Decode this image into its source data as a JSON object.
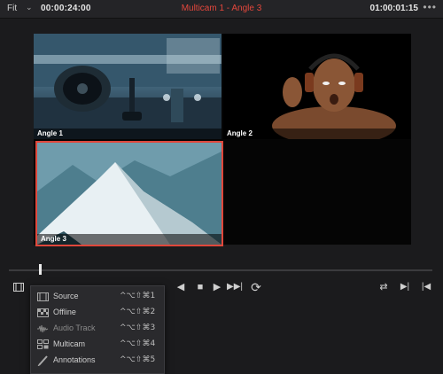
{
  "topbar": {
    "fit_label": "Fit",
    "fit_chevron": "⌄",
    "timecode_left": "00:00:24:00",
    "title": "Multicam 1 - Angle 3",
    "timecode_right": "01:00:01:15",
    "more_icon": "•••"
  },
  "angles": [
    {
      "label": "Angle 1"
    },
    {
      "label": "Angle 2"
    },
    {
      "label": "Angle 3"
    }
  ],
  "controls": {
    "play_reverse": "◀",
    "stop": "■",
    "play": "▶",
    "next_clip": "▶▶|",
    "loop": "⟳",
    "right1": "⇄",
    "right2": "▶|",
    "right3": "|◀"
  },
  "menu": {
    "items": [
      {
        "label": "Source",
        "shortcut": "^⌥⇧⌘1",
        "icon": "film-icon"
      },
      {
        "label": "Offline",
        "shortcut": "^⌥⇧⌘2",
        "icon": "checker-icon"
      },
      {
        "label": "Audio Track",
        "shortcut": "^⌥⇧⌘3",
        "icon": "waveform-icon"
      },
      {
        "label": "Multicam",
        "shortcut": "^⌥⇧⌘4",
        "icon": "multicam-icon"
      },
      {
        "label": "Annotations",
        "shortcut": "^⌥⇧⌘5",
        "icon": "pen-icon"
      }
    ]
  },
  "colors": {
    "accent_red": "#e0473b",
    "background": "#1b1b1d"
  }
}
